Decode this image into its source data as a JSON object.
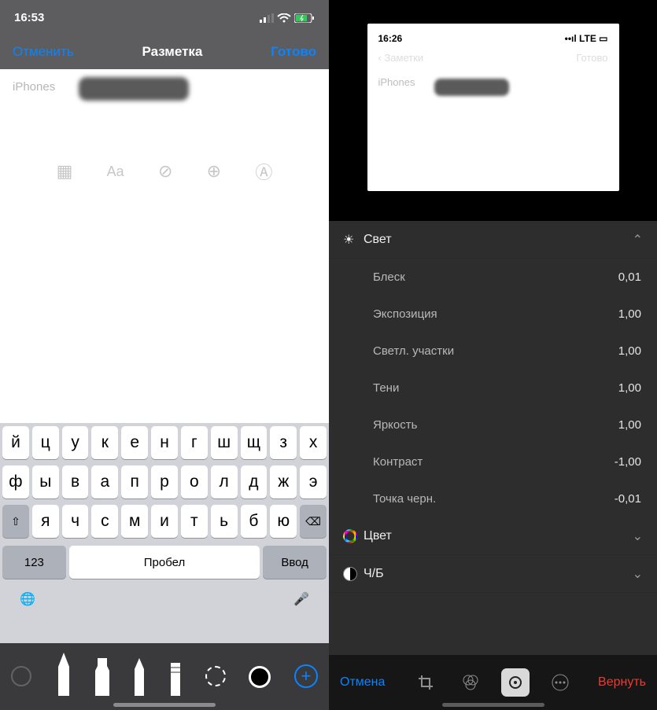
{
  "left": {
    "status": {
      "time": "16:53"
    },
    "nav": {
      "cancel": "Отменить",
      "title": "Разметка",
      "done": "Готово"
    },
    "note": {
      "text": "iPhones"
    },
    "keyboard": {
      "row1": [
        "й",
        "ц",
        "у",
        "к",
        "е",
        "н",
        "г",
        "ш",
        "щ",
        "з",
        "х"
      ],
      "row2": [
        "ф",
        "ы",
        "в",
        "а",
        "п",
        "р",
        "о",
        "л",
        "д",
        "ж",
        "э"
      ],
      "row3": [
        "я",
        "ч",
        "с",
        "м",
        "и",
        "т",
        "ь",
        "б",
        "ю"
      ],
      "numbers": "123",
      "space": "Пробел",
      "enter": "Ввод"
    }
  },
  "right": {
    "preview": {
      "time": "16:26",
      "signal": "LTE",
      "nav_back": "Заметки",
      "nav_done": "Готово",
      "text": "iPhones"
    },
    "sections": {
      "light": {
        "label": "Свет",
        "items": [
          {
            "label": "Блеск",
            "value": "0,01"
          },
          {
            "label": "Экспозиция",
            "value": "1,00"
          },
          {
            "label": "Светл. участки",
            "value": "1,00"
          },
          {
            "label": "Тени",
            "value": "1,00"
          },
          {
            "label": "Яркость",
            "value": "1,00"
          },
          {
            "label": "Контраст",
            "value": "-1,00"
          },
          {
            "label": "Точка черн.",
            "value": "-0,01"
          }
        ]
      },
      "color": {
        "label": "Цвет"
      },
      "bw": {
        "label": "Ч/Б"
      }
    },
    "toolbar": {
      "cancel": "Отмена",
      "revert": "Вернуть"
    }
  }
}
